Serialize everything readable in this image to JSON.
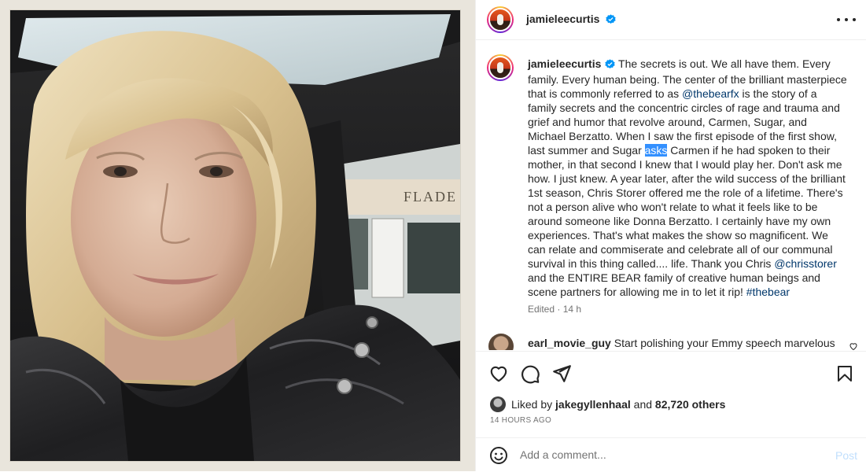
{
  "post": {
    "author": "jamieleecurtis",
    "verified": true
  },
  "caption": {
    "username": "jamieleecurtis",
    "text_1": "The secrets is out. We all have them. Every family. Every human being. The center of the brilliant masterpiece that is commonly referred to as ",
    "mention_1": "@thebearfx",
    "text_2": " is the story of a family secrets and the concentric circles of rage and trauma and grief and humor that revolve around, Carmen, Sugar, and Michael Berzatto. When I saw the first episode of the first show, last summer and Sugar ",
    "highlight": "asks",
    "text_3": " Carmen if he had spoken to their mother, in that second I knew that I would play her. Don't ask me how. I just knew. A year later, after the wild success of the brilliant 1st season, Chris Storer offered me the role of a lifetime. There's not a person alive who won't relate to what it feels like to be around someone like Donna Berzatto. I certainly have my own experiences. That's what makes the show so magnificent. We can relate and commiserate and celebrate all of our communal survival in this thing called.... life. Thank you Chris ",
    "mention_2": "@chrisstorer",
    "text_4": " and the ENTIRE BEAR family of creative human beings and scene partners for allowing me in to let it rip! ",
    "hashtag": "#thebear",
    "edited": "Edited",
    "separator": "·",
    "time": "14 h"
  },
  "comment": {
    "username": "earl_movie_guy",
    "text": "Start polishing your Emmy speech marvelous"
  },
  "likes": {
    "prefix": "Liked by",
    "user": "jakegyllenhaal",
    "and": "and",
    "others": "82,720 others"
  },
  "time_ago": "14 HOURS AGO",
  "comment_box": {
    "placeholder": "Add a comment...",
    "post_label": "Post"
  },
  "icons": {
    "like": "heart-icon",
    "comment": "comment-icon",
    "share": "paper-plane-icon",
    "save": "bookmark-icon",
    "emoji": "smiley-icon",
    "more": "more-horizontal-icon"
  },
  "colors": {
    "link": "#00376b",
    "verified": "#0095f6",
    "post_disabled": "#c0dffd",
    "selection": "#3390ff"
  }
}
